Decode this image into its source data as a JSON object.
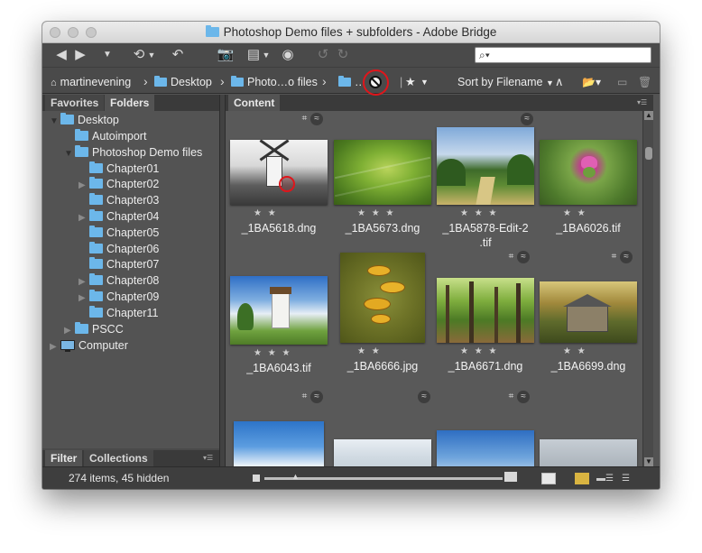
{
  "window": {
    "title": "Photoshop Demo files + subfolders - Adobe Bridge"
  },
  "search": {
    "value": "",
    "placeholder": ""
  },
  "breadcrumb": {
    "items": [
      "martinevening",
      "Desktop",
      "Photo…o files",
      "…"
    ],
    "sort_label": "Sort by Filename"
  },
  "left_panel": {
    "tabs": [
      "Favorites",
      "Folders"
    ],
    "active_tab": "Folders",
    "tree": [
      {
        "label": "Desktop",
        "level": 0,
        "expanded": true,
        "type": "folder"
      },
      {
        "label": "Autoimport",
        "level": 1,
        "expanded": false,
        "type": "folder"
      },
      {
        "label": "Photoshop Demo files",
        "level": 1,
        "expanded": true,
        "type": "folder"
      },
      {
        "label": "Chapter01",
        "level": 2,
        "type": "folder",
        "has_children": false
      },
      {
        "label": "Chapter02",
        "level": 2,
        "type": "folder",
        "has_children": true
      },
      {
        "label": "Chapter03",
        "level": 2,
        "type": "folder",
        "has_children": false
      },
      {
        "label": "Chapter04",
        "level": 2,
        "type": "folder",
        "has_children": true
      },
      {
        "label": "Chapter05",
        "level": 2,
        "type": "folder",
        "has_children": false
      },
      {
        "label": "Chapter06",
        "level": 2,
        "type": "folder",
        "has_children": false
      },
      {
        "label": "Chapter07",
        "level": 2,
        "type": "folder",
        "has_children": false
      },
      {
        "label": "Chapter08",
        "level": 2,
        "type": "folder",
        "has_children": true
      },
      {
        "label": "Chapter09",
        "level": 2,
        "type": "folder",
        "has_children": true
      },
      {
        "label": "Chapter11",
        "level": 2,
        "type": "folder",
        "has_children": false
      },
      {
        "label": "PSCC",
        "level": 1,
        "type": "folder",
        "has_children": true
      },
      {
        "label": "Computer",
        "level": 0,
        "type": "computer",
        "has_children": true
      }
    ],
    "bottom_tabs": [
      "Filter",
      "Collections"
    ]
  },
  "content": {
    "tab": "Content",
    "items": [
      {
        "name": "_1BA5618.dng",
        "stars": "★ ★",
        "crop": true,
        "stack": true,
        "rejected": true
      },
      {
        "name": "_1BA5673.dng",
        "stars": "★ ★ ★",
        "crop": false,
        "stack": false
      },
      {
        "name": "_1BA5878-Edit-2.tif",
        "name_lines": [
          "_1BA5878-Edit-2",
          ".tif"
        ],
        "stars": "★ ★ ★",
        "crop": false,
        "stack": true
      },
      {
        "name": "_1BA6026.tif",
        "stars": "★ ★",
        "crop": false,
        "stack": false
      },
      {
        "name": "_1BA6043.tif",
        "stars": "★ ★ ★",
        "crop": false,
        "stack": false
      },
      {
        "name": "_1BA6666.jpg",
        "stars": "★ ★",
        "crop": false,
        "stack": false
      },
      {
        "name": "_1BA6671.dng",
        "stars": "★ ★ ★",
        "crop": true,
        "stack": true
      },
      {
        "name": "_1BA6699.dng",
        "stars": "★ ★",
        "crop": true,
        "stack": true
      },
      {
        "name": "",
        "stars": "",
        "crop": true,
        "stack": true
      },
      {
        "name": "",
        "stars": "",
        "crop": false,
        "stack": true
      },
      {
        "name": "",
        "stars": "",
        "crop": true,
        "stack": true
      },
      {
        "name": "",
        "stars": "",
        "crop": false,
        "stack": false
      }
    ]
  },
  "status": {
    "text": "274 items, 45 hidden"
  },
  "colors": {
    "accent_folder": "#6cb7ea",
    "highlight_ring": "#e0151b",
    "panel_bg": "#535353"
  }
}
